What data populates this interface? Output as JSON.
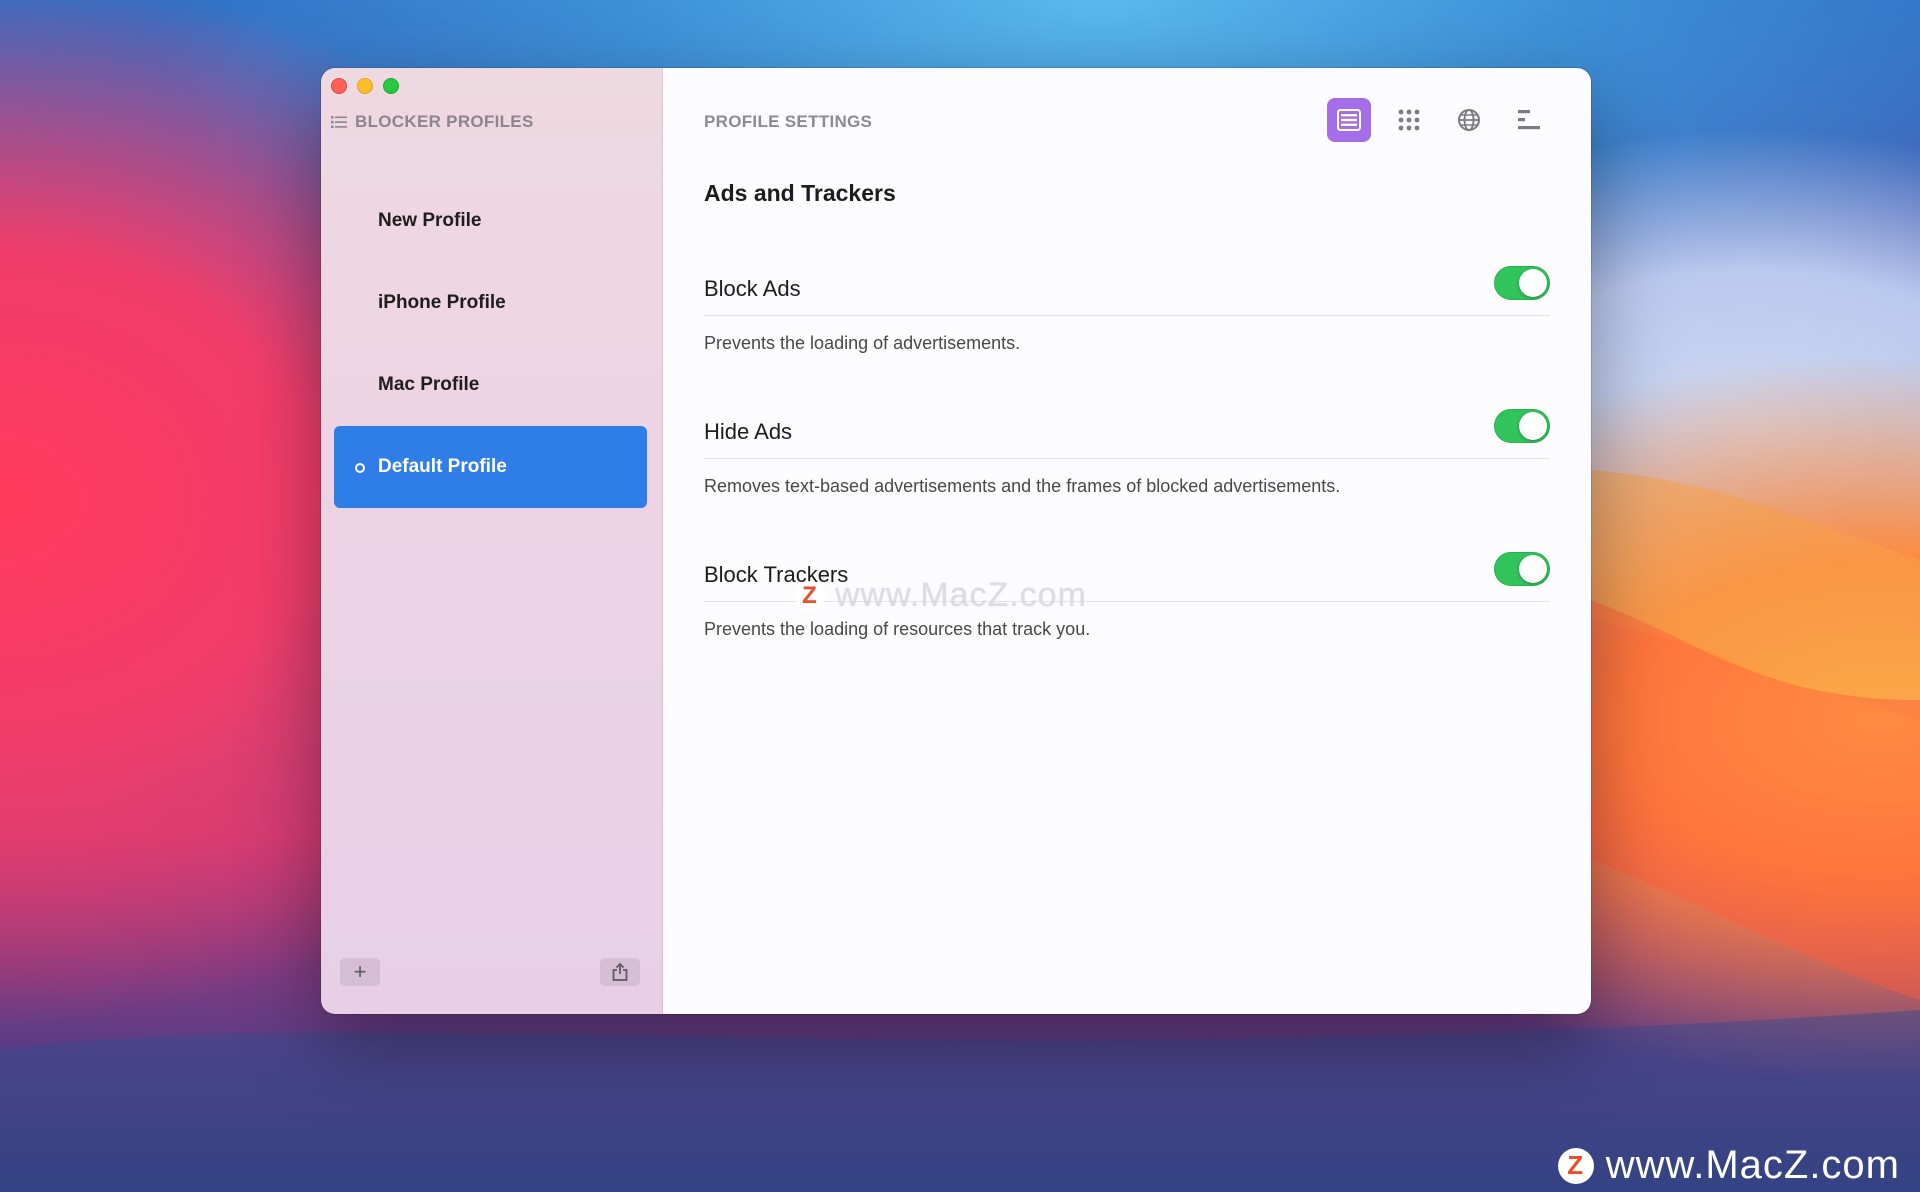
{
  "sidebar": {
    "header": "BLOCKER PROFILES",
    "items": [
      {
        "label": "New Profile",
        "selected": false
      },
      {
        "label": "iPhone Profile",
        "selected": false
      },
      {
        "label": "Mac Profile",
        "selected": false
      },
      {
        "label": "Default Profile",
        "selected": true
      }
    ],
    "add_label": "+"
  },
  "main": {
    "header": "PROFILE SETTINGS",
    "section_title": "Ads and Trackers",
    "settings": [
      {
        "label": "Block Ads",
        "description": "Prevents the loading of advertisements.",
        "enabled": true
      },
      {
        "label": "Hide Ads",
        "description": "Removes text-based advertisements and the frames of blocked advertisements.",
        "enabled": true
      },
      {
        "label": "Block Trackers",
        "description": "Prevents the loading of resources that track you.",
        "enabled": true
      }
    ],
    "toolbar": {
      "icons": [
        "list-view-icon",
        "grid-icon",
        "globe-icon",
        "outline-icon"
      ],
      "active_index": 0
    }
  },
  "watermark": {
    "text": "www.MacZ.com",
    "logo_letter": "Z"
  },
  "colors": {
    "selection": "#2f7ee8",
    "toggle_on": "#31c45a",
    "toolbar_active": "#a56de8"
  }
}
